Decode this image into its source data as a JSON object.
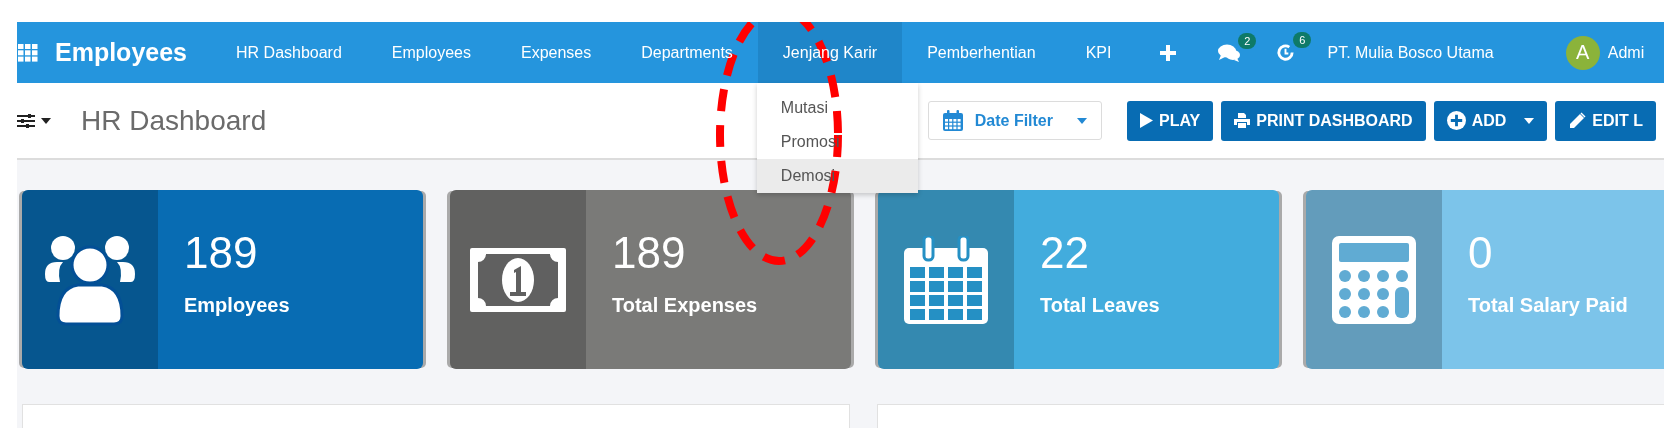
{
  "navbar": {
    "app_title": "Employees",
    "menu": [
      {
        "label": "HR Dashboard",
        "selected": false
      },
      {
        "label": "Employees",
        "selected": false
      },
      {
        "label": "Expenses",
        "selected": false
      },
      {
        "label": "Departments",
        "selected": false
      },
      {
        "label": "Jenjang Karir",
        "selected": true,
        "expanded": true
      },
      {
        "label": "Pemberhentian",
        "selected": false
      },
      {
        "label": "KPI",
        "selected": false
      }
    ],
    "messages_badge": "2",
    "activities_badge": "6",
    "company": "PT. Mulia Bosco Utama",
    "user": {
      "initial": "A",
      "name": "Admi"
    }
  },
  "dropdown": {
    "items": [
      {
        "label": "Mutasi",
        "selected": false
      },
      {
        "label": "Promosi",
        "selected": false
      },
      {
        "label": "Demosi",
        "selected": true
      }
    ]
  },
  "toolbar": {
    "title": "HR Dashboard",
    "date_filter": "Date Filter",
    "buttons": [
      {
        "label": "PLAY",
        "kind": "play"
      },
      {
        "label": "PRINT DASHBOARD",
        "kind": "print"
      },
      {
        "label": "ADD",
        "kind": "add"
      },
      {
        "label": "EDIT L",
        "kind": "edit"
      }
    ]
  },
  "cards": [
    {
      "value": "189",
      "label": "Employees",
      "kind": "users",
      "color": "#086cb3"
    },
    {
      "value": "189",
      "label": "Total Expenses",
      "kind": "money",
      "color": "#7a7a78"
    },
    {
      "value": "22",
      "label": "Total Leaves",
      "kind": "calendar",
      "color": "#42acdd"
    },
    {
      "value": "0",
      "label": "Total Salary Paid",
      "kind": "calculator",
      "color": "#7cc4ea"
    }
  ],
  "annotation": {
    "kind": "dashed-ellipse"
  }
}
